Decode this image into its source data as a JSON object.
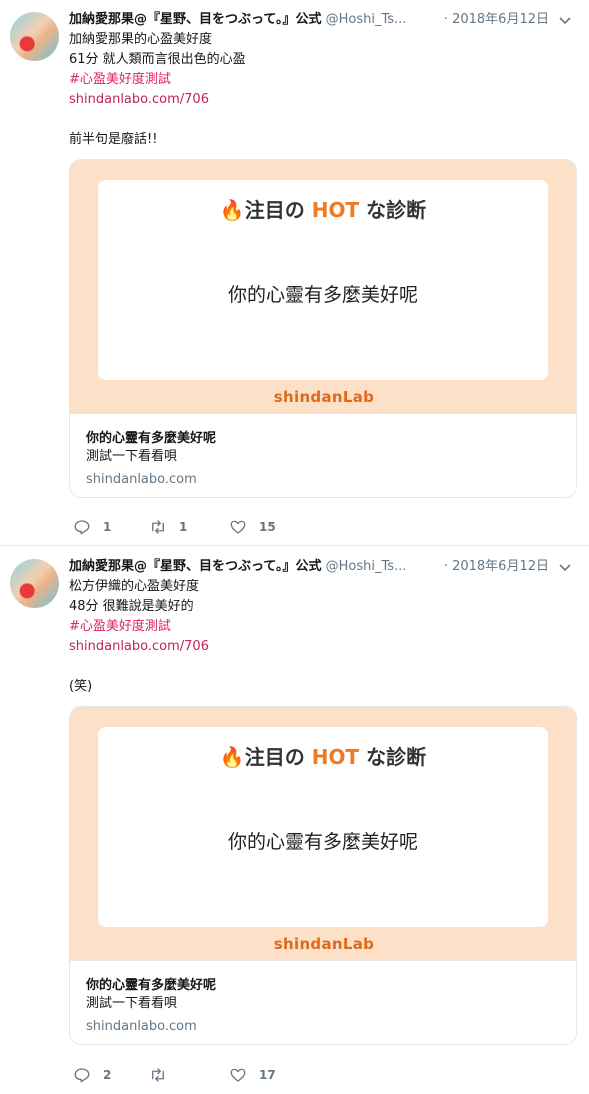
{
  "tweets": [
    {
      "name": "加納愛那果@『星野、目をつぶって。』公式",
      "handle": "@Hoshi_Ts...",
      "date": "· 2018年6月12日",
      "lines": [
        "加納愛那果的心盈美好度",
        "61分 就人類而言很出色的心盈"
      ],
      "hashtag": "#心盈美好度測試",
      "link": "shindanlabo.com/706",
      "extra": "前半句是廢話!!",
      "card": {
        "banner": "注目の",
        "banner_hot": "HOT",
        "banner_tail": "な診断",
        "question": "你的心靈有多麼美好呢",
        "brand": "shindanLab",
        "title": "你的心靈有多麼美好呢",
        "desc": "測試一下看看唄",
        "domain": "shindanlabo.com"
      },
      "reply_count": "1",
      "retweet_count": "1",
      "like_count": "15"
    },
    {
      "name": "加納愛那果@『星野、目をつぶって。』公式",
      "handle": "@Hoshi_Ts...",
      "date": "· 2018年6月12日",
      "lines": [
        "松方伊織的心盈美好度",
        "48分 很難說是美好的"
      ],
      "hashtag": "#心盈美好度測試",
      "link": "shindanlabo.com/706",
      "extra": "(笑)",
      "card": {
        "banner": "注目の",
        "banner_hot": "HOT",
        "banner_tail": "な診断",
        "question": "你的心靈有多麼美好呢",
        "brand": "shindanLab",
        "title": "你的心靈有多麼美好呢",
        "desc": "測試一下看看唄",
        "domain": "shindanlabo.com"
      },
      "reply_count": "2",
      "retweet_count": "",
      "like_count": "17"
    }
  ],
  "colors": {
    "accent": "#e0245e",
    "card_bg": "#fde0c8",
    "hot": "#f07a24",
    "muted": "#657786"
  },
  "icons": [
    "reply-icon",
    "retweet-icon",
    "like-icon",
    "chevron-down-icon",
    "flame-icon"
  ]
}
